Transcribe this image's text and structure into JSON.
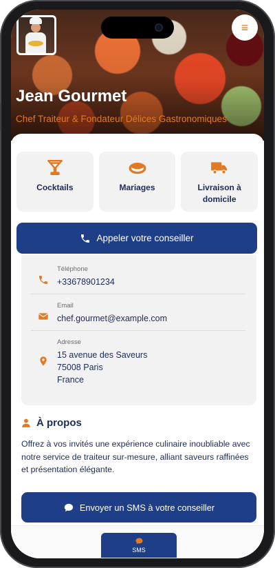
{
  "header": {
    "name": "Jean Gourmet",
    "title": "Chef Traiteur & Fondateur Délices Gastronomiques",
    "menu_icon": "≡"
  },
  "services": [
    {
      "label": "Cocktails",
      "icon": "cocktail-icon"
    },
    {
      "label": "Mariages",
      "icon": "ring-icon"
    },
    {
      "label": "Livraison à domicile",
      "icon": "truck-icon"
    }
  ],
  "call_button": {
    "label": "Appeler votre conseiller",
    "icon": "phone-icon"
  },
  "contact": {
    "phone": {
      "label": "Téléphone",
      "value": "+33678901234"
    },
    "email": {
      "label": "Email",
      "value": "chef.gourmet@example.com"
    },
    "address": {
      "label": "Adresse",
      "line1": "15 avenue des Saveurs",
      "line2": "75008 Paris",
      "line3": "France"
    }
  },
  "about": {
    "heading": "À propos",
    "text": "Offrez à vos invités une expérience culinaire inoubliable avec notre service de traiteur sur-mesure, alliant saveurs raffinées et présentation élégante."
  },
  "sms_button": {
    "label": "Envoyer un SMS à votre conseiller",
    "icon": "chat-icon"
  },
  "bottom_nav": {
    "sms_label": "SMS"
  },
  "colors": {
    "accent": "#e07a25",
    "primary": "#1f3e88",
    "text": "#1c2b55"
  }
}
